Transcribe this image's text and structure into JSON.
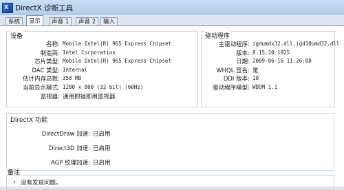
{
  "window": {
    "title": "DirectX 诊断工具"
  },
  "tabs": [
    {
      "label": "系统"
    },
    {
      "label": "显示"
    },
    {
      "label": "声音 1"
    },
    {
      "label": "声音 2"
    },
    {
      "label": "输入"
    }
  ],
  "device": {
    "title": "设备",
    "rows": [
      {
        "label": "名称:",
        "value": "Mobile Intel(R) 965 Express Chipset"
      },
      {
        "label": "制造商:",
        "value": "Intel Corporation"
      },
      {
        "label": "芯片类型:",
        "value": "Mobile Intel(R) 965 Express Chipset"
      },
      {
        "label": "DAC 类型:",
        "value": "Internal"
      },
      {
        "label": "估计内存总数:",
        "value": "358 MB"
      },
      {
        "label": "当前显示模式:",
        "value": "1280 x 800 (32 bit) (60Hz)"
      },
      {
        "label": "监视器:",
        "value": "通用即插即用监视器"
      }
    ]
  },
  "driver": {
    "title": "驱动程序",
    "rows": [
      {
        "label": "主驱动程序:",
        "value": "igdumdx32.dll,igd10umd32.dll"
      },
      {
        "label": "版本:",
        "value": "8.15.10.1825"
      },
      {
        "label": "日期:",
        "value": "2009-06-16 11:26:08"
      },
      {
        "label": "WHQL 签名:",
        "value": "是"
      },
      {
        "label": "DDI 版本:",
        "value": "10"
      },
      {
        "label": "驱动程序模型:",
        "value": "WDDM 1.1"
      }
    ]
  },
  "directx": {
    "title": "DirectX 功能",
    "rows": [
      {
        "label": "DirectDraw 加速:",
        "value": "已启用"
      },
      {
        "label": "Direct3D 加速:",
        "value": "已启用"
      },
      {
        "label": "AGP 纹理加速:",
        "value": "已启用"
      }
    ]
  },
  "notes": {
    "title": "备注",
    "items": [
      "没有发现问题。"
    ]
  }
}
